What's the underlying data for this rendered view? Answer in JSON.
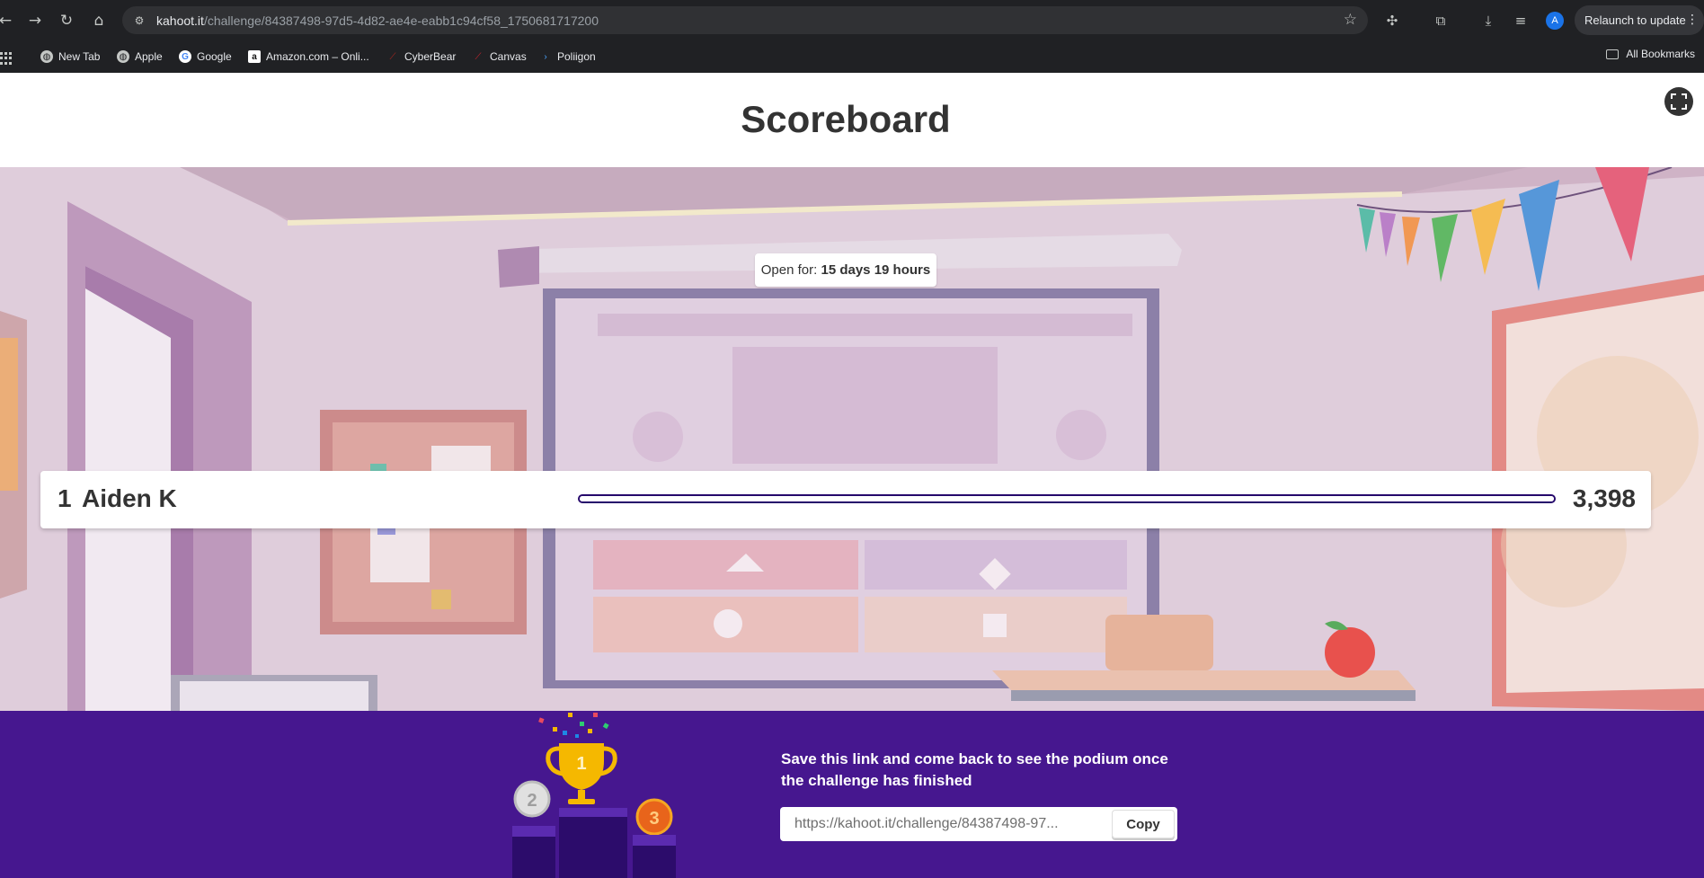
{
  "browser": {
    "url_host": "kahoot.it",
    "url_path": "/challenge/84387498-97d5-4d82-ae4e-eabb1c94cf58_1750681717200",
    "relaunch_label": "Relaunch to update",
    "profile_initial": "A",
    "bookmarks": [
      {
        "label": "New Tab",
        "icon": "globe-icon"
      },
      {
        "label": "Apple",
        "icon": "globe-icon"
      },
      {
        "label": "Google",
        "icon": "google-icon"
      },
      {
        "label": "Amazon.com – Onli...",
        "icon": "amazon-icon"
      },
      {
        "label": "CyberBear",
        "icon": "cyberbear-icon"
      },
      {
        "label": "Canvas",
        "icon": "canvas-icon"
      },
      {
        "label": "Poliigon",
        "icon": "poliigon-icon"
      }
    ],
    "all_bookmarks_label": "All Bookmarks"
  },
  "page": {
    "title": "Scoreboard",
    "open_for_label": "Open for:",
    "open_for_value": "15 days 19 hours"
  },
  "leaderboard": [
    {
      "rank": "1",
      "name": "Aiden K",
      "score": "3,398",
      "score_fraction": 1.0
    }
  ],
  "footer": {
    "message": "Save this link and come back to see the podium once the challenge has finished",
    "link_value": "https://kahoot.it/challenge/84387498-97...",
    "copy_label": "Copy",
    "podium": [
      "1",
      "2",
      "3"
    ]
  },
  "colors": {
    "footer_bg": "#46178f",
    "score_bar_border": "#25076b",
    "trophy_gold": "#f5b800"
  }
}
